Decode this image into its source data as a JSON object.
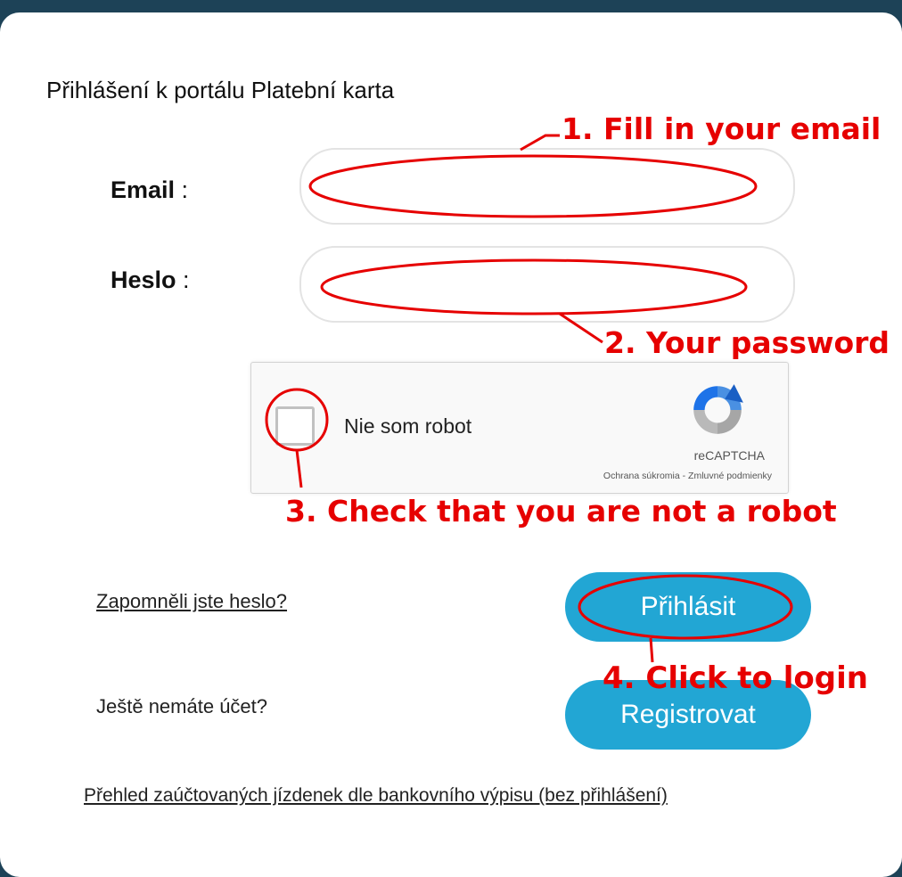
{
  "dialog": {
    "title": "Přihlášení k portálu Platební karta"
  },
  "form": {
    "email_label": "Email",
    "password_label": "Heslo",
    "separator": " :",
    "email_value": "",
    "password_value": ""
  },
  "captcha": {
    "checkbox_label": "Nie som robot",
    "brand": "reCAPTCHA",
    "links": "Ochrana súkromia - Zmluvné podmienky",
    "logo_icon": "recaptcha-logo-icon"
  },
  "actions": {
    "forgot_password": "Zapomněli jste heslo?",
    "login_button": "Přihlásit",
    "no_account": "Ještě nemáte účet?",
    "register_button": "Registrovat",
    "statement_link": "Přehled zaúčtovaných jízdenek dle bankovního výpisu (bez přihlášení)"
  },
  "annotations": {
    "step1": "1. Fill in your email",
    "step2": "2. Your password",
    "step3": "3. Check that you are not a robot",
    "step4": "4. Click to login",
    "color": "#e60000"
  },
  "colors": {
    "header_bg": "#1d4257",
    "button_bg": "#22a6d4"
  }
}
